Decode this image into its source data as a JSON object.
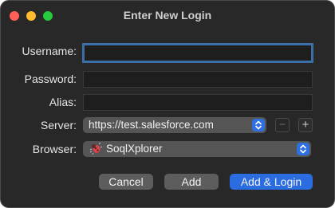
{
  "window": {
    "title": "Enter New Login"
  },
  "form": {
    "username": {
      "label": "Username:",
      "value": ""
    },
    "password": {
      "label": "Password:",
      "value": ""
    },
    "alias": {
      "label": "Alias:",
      "value": ""
    },
    "server": {
      "label": "Server:",
      "value": "https://test.salesforce.com",
      "remove_label": "−",
      "add_label": "+"
    },
    "browser": {
      "label": "Browser:",
      "value": "SoqlXplorer"
    }
  },
  "buttons": {
    "cancel": "Cancel",
    "add": "Add",
    "add_login": "Add & Login"
  },
  "colors": {
    "window_bg": "#282828",
    "accent": "#2b6de0",
    "focus_ring": "#3a6fa8"
  },
  "icons": {
    "browser_app": "soqlxplorer-bug-icon",
    "popup_chevron": "chevron-up-down-icon"
  }
}
